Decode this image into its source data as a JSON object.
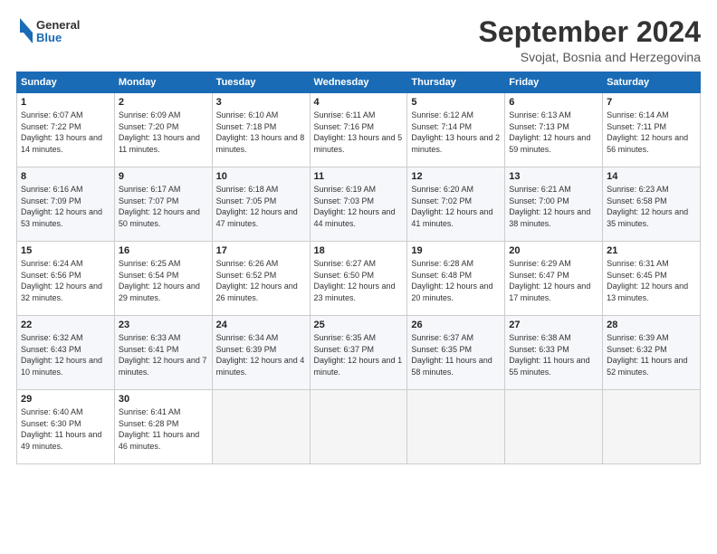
{
  "header": {
    "logo_general": "General",
    "logo_blue": "Blue",
    "month_title": "September 2024",
    "subtitle": "Svojat, Bosnia and Herzegovina"
  },
  "days_of_week": [
    "Sunday",
    "Monday",
    "Tuesday",
    "Wednesday",
    "Thursday",
    "Friday",
    "Saturday"
  ],
  "weeks": [
    [
      {
        "day": "1",
        "sunrise": "6:07 AM",
        "sunset": "7:22 PM",
        "daylight": "13 hours and 14 minutes."
      },
      {
        "day": "2",
        "sunrise": "6:09 AM",
        "sunset": "7:20 PM",
        "daylight": "13 hours and 11 minutes."
      },
      {
        "day": "3",
        "sunrise": "6:10 AM",
        "sunset": "7:18 PM",
        "daylight": "13 hours and 8 minutes."
      },
      {
        "day": "4",
        "sunrise": "6:11 AM",
        "sunset": "7:16 PM",
        "daylight": "13 hours and 5 minutes."
      },
      {
        "day": "5",
        "sunrise": "6:12 AM",
        "sunset": "7:14 PM",
        "daylight": "13 hours and 2 minutes."
      },
      {
        "day": "6",
        "sunrise": "6:13 AM",
        "sunset": "7:13 PM",
        "daylight": "12 hours and 59 minutes."
      },
      {
        "day": "7",
        "sunrise": "6:14 AM",
        "sunset": "7:11 PM",
        "daylight": "12 hours and 56 minutes."
      }
    ],
    [
      {
        "day": "8",
        "sunrise": "6:16 AM",
        "sunset": "7:09 PM",
        "daylight": "12 hours and 53 minutes."
      },
      {
        "day": "9",
        "sunrise": "6:17 AM",
        "sunset": "7:07 PM",
        "daylight": "12 hours and 50 minutes."
      },
      {
        "day": "10",
        "sunrise": "6:18 AM",
        "sunset": "7:05 PM",
        "daylight": "12 hours and 47 minutes."
      },
      {
        "day": "11",
        "sunrise": "6:19 AM",
        "sunset": "7:03 PM",
        "daylight": "12 hours and 44 minutes."
      },
      {
        "day": "12",
        "sunrise": "6:20 AM",
        "sunset": "7:02 PM",
        "daylight": "12 hours and 41 minutes."
      },
      {
        "day": "13",
        "sunrise": "6:21 AM",
        "sunset": "7:00 PM",
        "daylight": "12 hours and 38 minutes."
      },
      {
        "day": "14",
        "sunrise": "6:23 AM",
        "sunset": "6:58 PM",
        "daylight": "12 hours and 35 minutes."
      }
    ],
    [
      {
        "day": "15",
        "sunrise": "6:24 AM",
        "sunset": "6:56 PM",
        "daylight": "12 hours and 32 minutes."
      },
      {
        "day": "16",
        "sunrise": "6:25 AM",
        "sunset": "6:54 PM",
        "daylight": "12 hours and 29 minutes."
      },
      {
        "day": "17",
        "sunrise": "6:26 AM",
        "sunset": "6:52 PM",
        "daylight": "12 hours and 26 minutes."
      },
      {
        "day": "18",
        "sunrise": "6:27 AM",
        "sunset": "6:50 PM",
        "daylight": "12 hours and 23 minutes."
      },
      {
        "day": "19",
        "sunrise": "6:28 AM",
        "sunset": "6:48 PM",
        "daylight": "12 hours and 20 minutes."
      },
      {
        "day": "20",
        "sunrise": "6:29 AM",
        "sunset": "6:47 PM",
        "daylight": "12 hours and 17 minutes."
      },
      {
        "day": "21",
        "sunrise": "6:31 AM",
        "sunset": "6:45 PM",
        "daylight": "12 hours and 13 minutes."
      }
    ],
    [
      {
        "day": "22",
        "sunrise": "6:32 AM",
        "sunset": "6:43 PM",
        "daylight": "12 hours and 10 minutes."
      },
      {
        "day": "23",
        "sunrise": "6:33 AM",
        "sunset": "6:41 PM",
        "daylight": "12 hours and 7 minutes."
      },
      {
        "day": "24",
        "sunrise": "6:34 AM",
        "sunset": "6:39 PM",
        "daylight": "12 hours and 4 minutes."
      },
      {
        "day": "25",
        "sunrise": "6:35 AM",
        "sunset": "6:37 PM",
        "daylight": "12 hours and 1 minute."
      },
      {
        "day": "26",
        "sunrise": "6:37 AM",
        "sunset": "6:35 PM",
        "daylight": "11 hours and 58 minutes."
      },
      {
        "day": "27",
        "sunrise": "6:38 AM",
        "sunset": "6:33 PM",
        "daylight": "11 hours and 55 minutes."
      },
      {
        "day": "28",
        "sunrise": "6:39 AM",
        "sunset": "6:32 PM",
        "daylight": "11 hours and 52 minutes."
      }
    ],
    [
      {
        "day": "29",
        "sunrise": "6:40 AM",
        "sunset": "6:30 PM",
        "daylight": "11 hours and 49 minutes."
      },
      {
        "day": "30",
        "sunrise": "6:41 AM",
        "sunset": "6:28 PM",
        "daylight": "11 hours and 46 minutes."
      },
      null,
      null,
      null,
      null,
      null
    ]
  ]
}
